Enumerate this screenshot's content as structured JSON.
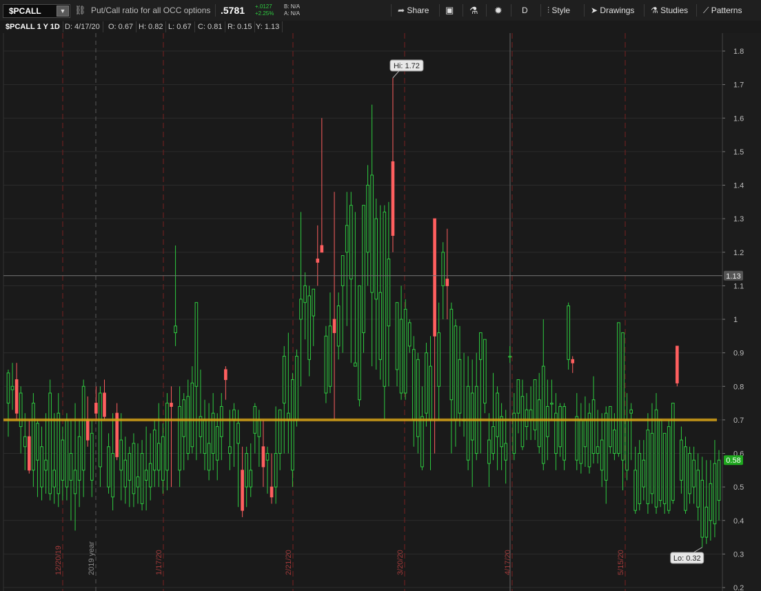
{
  "toolbar": {
    "symbol": "$PCALL",
    "description": "Put/Call ratio for all OCC options",
    "last": ".5781",
    "change": "+.0127",
    "change_pct": "+2.25%",
    "bid": "B: N/A",
    "ask": "A: N/A",
    "share_label": "Share",
    "timeframe_label": "D",
    "style_label": "Style",
    "drawings_label": "Drawings",
    "studies_label": "Studies",
    "patterns_label": "Patterns"
  },
  "infobar": {
    "title": "$PCALL 1 Y 1D",
    "date": "D: 4/17/20",
    "open": "O: 0.67",
    "high": "H: 0.82",
    "low": "L: 0.67",
    "close": "C: 0.81",
    "range": "R: 0.15",
    "y": "Y: 1.13"
  },
  "colors": {
    "up": "#2ecc40",
    "down": "#ff5f5f",
    "hline": "#d4a017",
    "grid": "#2c2c2c",
    "event": "#7a2020"
  },
  "chart_data": {
    "type": "candlestick",
    "title": "$PCALL 1 Y 1D",
    "ylim": [
      0.2,
      1.85
    ],
    "yticks": [
      0.2,
      0.3,
      0.4,
      0.5,
      0.6,
      0.7,
      0.8,
      0.9,
      1,
      1.1,
      1.2,
      1.3,
      1.4,
      1.5,
      1.6,
      1.7,
      1.8
    ],
    "date_labels": [
      "12/20/19",
      "2019 year",
      "1/17/20",
      "2/21/20",
      "3/20/20",
      "4/17/20",
      "5/15/20"
    ],
    "hi_label": "Hi: 1.72",
    "lo_label": "Lo: 0.32",
    "hline_value": 0.7,
    "crosshair_value": 1.13,
    "crosshair_label": "1.13",
    "last_label": "0.58",
    "hi": 1.72,
    "lo": 0.32,
    "candles": [
      [
        0.75,
        0.85,
        0.65,
        0.84
      ],
      [
        0.79,
        0.87,
        0.73,
        0.8
      ],
      [
        0.82,
        0.87,
        0.7,
        0.72
      ],
      [
        0.68,
        0.8,
        0.6,
        0.78
      ],
      [
        0.62,
        0.72,
        0.55,
        0.65
      ],
      [
        0.65,
        0.7,
        0.54,
        0.55
      ],
      [
        0.55,
        0.78,
        0.5,
        0.75
      ],
      [
        0.58,
        0.7,
        0.47,
        0.69
      ],
      [
        0.5,
        0.68,
        0.46,
        0.62
      ],
      [
        0.55,
        0.72,
        0.48,
        0.58
      ],
      [
        0.48,
        0.82,
        0.46,
        0.78
      ],
      [
        0.5,
        0.72,
        0.45,
        0.55
      ],
      [
        0.48,
        0.78,
        0.44,
        0.72
      ],
      [
        0.52,
        0.68,
        0.46,
        0.64
      ],
      [
        0.5,
        0.72,
        0.46,
        0.7
      ],
      [
        0.52,
        0.7,
        0.4,
        0.6
      ],
      [
        0.48,
        0.75,
        0.37,
        0.55
      ],
      [
        0.52,
        0.7,
        0.44,
        0.65
      ],
      [
        0.55,
        0.82,
        0.47,
        0.8
      ],
      [
        0.7,
        0.77,
        0.62,
        0.64
      ],
      [
        0.52,
        0.7,
        0.47,
        0.66
      ],
      [
        0.75,
        0.8,
        0.7,
        0.72
      ],
      [
        0.56,
        0.8,
        0.5,
        0.78
      ],
      [
        0.78,
        0.82,
        0.7,
        0.71
      ],
      [
        0.5,
        0.66,
        0.48,
        0.62
      ],
      [
        0.47,
        0.72,
        0.43,
        0.6
      ],
      [
        0.72,
        0.75,
        0.58,
        0.59
      ],
      [
        0.55,
        0.72,
        0.46,
        0.64
      ],
      [
        0.5,
        0.65,
        0.45,
        0.58
      ],
      [
        0.52,
        0.62,
        0.44,
        0.6
      ],
      [
        0.48,
        0.66,
        0.44,
        0.63
      ],
      [
        0.5,
        0.63,
        0.45,
        0.53
      ],
      [
        0.45,
        0.64,
        0.43,
        0.6
      ],
      [
        0.52,
        0.68,
        0.43,
        0.55
      ],
      [
        0.5,
        0.66,
        0.46,
        0.57
      ],
      [
        0.55,
        0.7,
        0.5,
        0.67
      ],
      [
        0.55,
        0.75,
        0.5,
        0.63
      ],
      [
        0.52,
        0.69,
        0.48,
        0.65
      ],
      [
        0.55,
        0.78,
        0.49,
        0.75
      ],
      [
        0.75,
        0.8,
        0.5,
        0.74
      ],
      [
        0.96,
        1.22,
        0.92,
        0.98
      ],
      [
        0.55,
        0.8,
        0.5,
        0.74
      ],
      [
        0.65,
        0.78,
        0.55,
        0.76
      ],
      [
        0.6,
        0.82,
        0.58,
        0.77
      ],
      [
        0.62,
        0.86,
        0.6,
        0.81
      ],
      [
        0.8,
        1.05,
        0.58,
        1.05
      ],
      [
        0.65,
        0.85,
        0.6,
        0.71
      ],
      [
        0.6,
        0.76,
        0.55,
        0.7
      ],
      [
        0.55,
        0.75,
        0.52,
        0.63
      ],
      [
        0.6,
        0.78,
        0.55,
        0.72
      ],
      [
        0.58,
        0.72,
        0.52,
        0.68
      ],
      [
        0.65,
        0.78,
        0.58,
        0.74
      ],
      [
        0.85,
        0.86,
        0.76,
        0.82
      ],
      [
        0.6,
        0.73,
        0.55,
        0.62
      ],
      [
        0.7,
        0.75,
        0.56,
        0.73
      ],
      [
        0.63,
        0.73,
        0.44,
        0.69
      ],
      [
        0.55,
        0.62,
        0.41,
        0.43
      ],
      [
        0.5,
        0.62,
        0.44,
        0.6
      ],
      [
        0.5,
        0.63,
        0.47,
        0.55
      ],
      [
        0.66,
        0.75,
        0.6,
        0.74
      ],
      [
        0.65,
        0.73,
        0.56,
        0.7
      ],
      [
        0.62,
        0.7,
        0.5,
        0.56
      ],
      [
        0.58,
        0.62,
        0.48,
        0.6
      ],
      [
        0.5,
        0.6,
        0.45,
        0.47
      ],
      [
        0.5,
        0.74,
        0.45,
        0.6
      ],
      [
        0.6,
        0.72,
        0.55,
        0.73
      ],
      [
        0.75,
        0.92,
        0.6,
        0.89
      ],
      [
        0.7,
        0.96,
        0.6,
        0.72
      ],
      [
        0.55,
        0.84,
        0.5,
        0.82
      ],
      [
        0.7,
        0.91,
        0.68,
        0.89
      ],
      [
        1.0,
        1.32,
        0.8,
        1.06
      ],
      [
        1.05,
        1.14,
        0.94,
        1.1
      ],
      [
        0.88,
        1.1,
        0.83,
        1.07
      ],
      [
        1.01,
        1.08,
        0.92,
        1.09
      ],
      [
        1.18,
        1.28,
        1.1,
        1.17
      ],
      [
        1.22,
        1.6,
        1.2,
        1.2
      ],
      [
        0.78,
        0.98,
        0.75,
        0.95
      ],
      [
        0.8,
        1.08,
        0.78,
        0.98
      ],
      [
        1.0,
        1.38,
        0.7,
        0.96
      ],
      [
        0.92,
        1.08,
        0.88,
        1.04
      ],
      [
        1.1,
        1.18,
        0.9,
        1.19
      ],
      [
        1.2,
        1.38,
        0.98,
        1.28
      ],
      [
        1.12,
        1.38,
        0.87,
        1.34
      ],
      [
        0.86,
        1.32,
        0.87,
        0.87
      ],
      [
        0.76,
        1.08,
        0.74,
        1.1
      ],
      [
        0.96,
        1.3,
        0.9,
        1.34
      ],
      [
        1.2,
        1.46,
        1.1,
        1.4
      ],
      [
        1.08,
        1.64,
        0.86,
        1.43
      ],
      [
        1.06,
        1.36,
        0.85,
        1.3
      ],
      [
        0.88,
        1.34,
        0.82,
        1.08
      ],
      [
        0.8,
        1.34,
        0.7,
        1.32
      ],
      [
        0.98,
        1.35,
        0.8,
        1.18
      ],
      [
        1.47,
        1.72,
        1.2,
        1.25
      ],
      [
        0.85,
        1.03,
        0.8,
        1.05
      ],
      [
        0.78,
        1.1,
        0.76,
        1.0
      ],
      [
        0.78,
        1.06,
        0.76,
        1.03
      ],
      [
        0.92,
        1.0,
        0.9,
        0.99
      ],
      [
        0.7,
        0.95,
        0.62,
        0.91
      ],
      [
        0.65,
        0.9,
        0.6,
        0.88
      ],
      [
        0.56,
        0.8,
        0.55,
        0.71
      ],
      [
        0.72,
        0.93,
        0.68,
        0.9
      ],
      [
        0.7,
        0.95,
        0.55,
        0.86
      ],
      [
        1.3,
        1.3,
        0.6,
        0.95
      ],
      [
        0.8,
        1.05,
        0.7,
        0.96
      ],
      [
        1.1,
        1.23,
        1.0,
        1.2
      ],
      [
        1.12,
        1.27,
        1.0,
        1.1
      ],
      [
        0.76,
        1.05,
        0.6,
        1.03
      ],
      [
        0.7,
        1.0,
        0.62,
        0.98
      ],
      [
        0.72,
        0.98,
        0.68,
        0.88
      ],
      [
        0.7,
        0.9,
        0.65,
        0.7
      ],
      [
        0.58,
        0.89,
        0.55,
        0.8
      ],
      [
        0.64,
        0.88,
        0.5,
        0.78
      ],
      [
        0.6,
        0.9,
        0.58,
        0.8
      ],
      [
        0.88,
        0.96,
        0.6,
        0.96
      ],
      [
        0.75,
        0.9,
        0.72,
        0.94
      ],
      [
        0.57,
        0.72,
        0.5,
        0.64
      ],
      [
        0.6,
        0.84,
        0.58,
        0.68
      ],
      [
        0.65,
        0.8,
        0.55,
        0.78
      ],
      [
        0.62,
        0.75,
        0.55,
        0.71
      ],
      [
        0.58,
        0.73,
        0.51,
        0.63
      ],
      [
        0.89,
        0.92,
        0.87,
        0.89
      ],
      [
        0.6,
        0.78,
        0.58,
        0.72
      ],
      [
        0.72,
        0.8,
        0.66,
        0.82
      ],
      [
        0.62,
        0.82,
        0.61,
        0.77
      ],
      [
        0.68,
        0.78,
        0.64,
        0.73
      ],
      [
        0.7,
        0.8,
        0.64,
        0.73
      ],
      [
        0.67,
        0.82,
        0.64,
        0.82
      ],
      [
        0.62,
        0.84,
        0.6,
        0.76
      ],
      [
        0.57,
        1.0,
        0.55,
        0.86
      ],
      [
        0.65,
        0.82,
        0.58,
        0.74
      ],
      [
        0.75,
        0.82,
        0.7,
        0.75
      ],
      [
        0.6,
        0.78,
        0.55,
        0.72
      ],
      [
        0.62,
        0.75,
        0.59,
        0.74
      ],
      [
        0.58,
        0.75,
        0.55,
        0.74
      ],
      [
        0.88,
        1.05,
        0.85,
        1.04
      ],
      [
        0.88,
        0.89,
        0.84,
        0.87
      ],
      [
        0.58,
        0.78,
        0.55,
        0.71
      ],
      [
        0.57,
        0.75,
        0.54,
        0.7
      ],
      [
        0.62,
        0.77,
        0.56,
        0.7
      ],
      [
        0.56,
        0.75,
        0.54,
        0.72
      ],
      [
        0.6,
        0.83,
        0.57,
        0.76
      ],
      [
        0.6,
        0.73,
        0.57,
        0.62
      ],
      [
        0.55,
        0.72,
        0.5,
        0.64
      ],
      [
        0.52,
        0.74,
        0.45,
        0.72
      ],
      [
        0.62,
        0.74,
        0.6,
        0.74
      ],
      [
        0.6,
        0.72,
        0.58,
        0.67
      ],
      [
        0.6,
        0.88,
        0.59,
        0.99
      ],
      [
        0.58,
        0.75,
        0.49,
        0.96
      ],
      [
        0.55,
        0.78,
        0.52,
        0.7
      ],
      [
        0.72,
        0.75,
        0.58,
        0.73
      ],
      [
        0.43,
        0.62,
        0.42,
        0.55
      ],
      [
        0.45,
        0.64,
        0.43,
        0.6
      ],
      [
        0.5,
        0.64,
        0.46,
        0.58
      ],
      [
        0.45,
        0.72,
        0.42,
        0.67
      ],
      [
        0.48,
        0.75,
        0.45,
        0.66
      ],
      [
        0.44,
        0.78,
        0.42,
        0.73
      ],
      [
        0.46,
        0.68,
        0.44,
        0.7
      ],
      [
        0.45,
        0.62,
        0.42,
        0.66
      ],
      [
        0.43,
        0.7,
        0.42,
        0.68
      ],
      [
        0.46,
        0.75,
        0.45,
        0.75
      ],
      [
        0.92,
        0.92,
        0.8,
        0.81
      ],
      [
        0.52,
        0.68,
        0.48,
        0.64
      ],
      [
        0.43,
        0.65,
        0.42,
        0.62
      ],
      [
        0.48,
        0.62,
        0.45,
        0.6
      ],
      [
        0.5,
        0.62,
        0.45,
        0.58
      ],
      [
        0.44,
        0.6,
        0.4,
        0.55
      ],
      [
        0.35,
        0.59,
        0.32,
        0.52
      ],
      [
        0.35,
        0.58,
        0.33,
        0.44
      ],
      [
        0.4,
        0.58,
        0.34,
        0.51
      ],
      [
        0.39,
        0.64,
        0.35,
        0.57
      ],
      [
        0.46,
        0.61,
        0.4,
        0.58
      ]
    ]
  }
}
